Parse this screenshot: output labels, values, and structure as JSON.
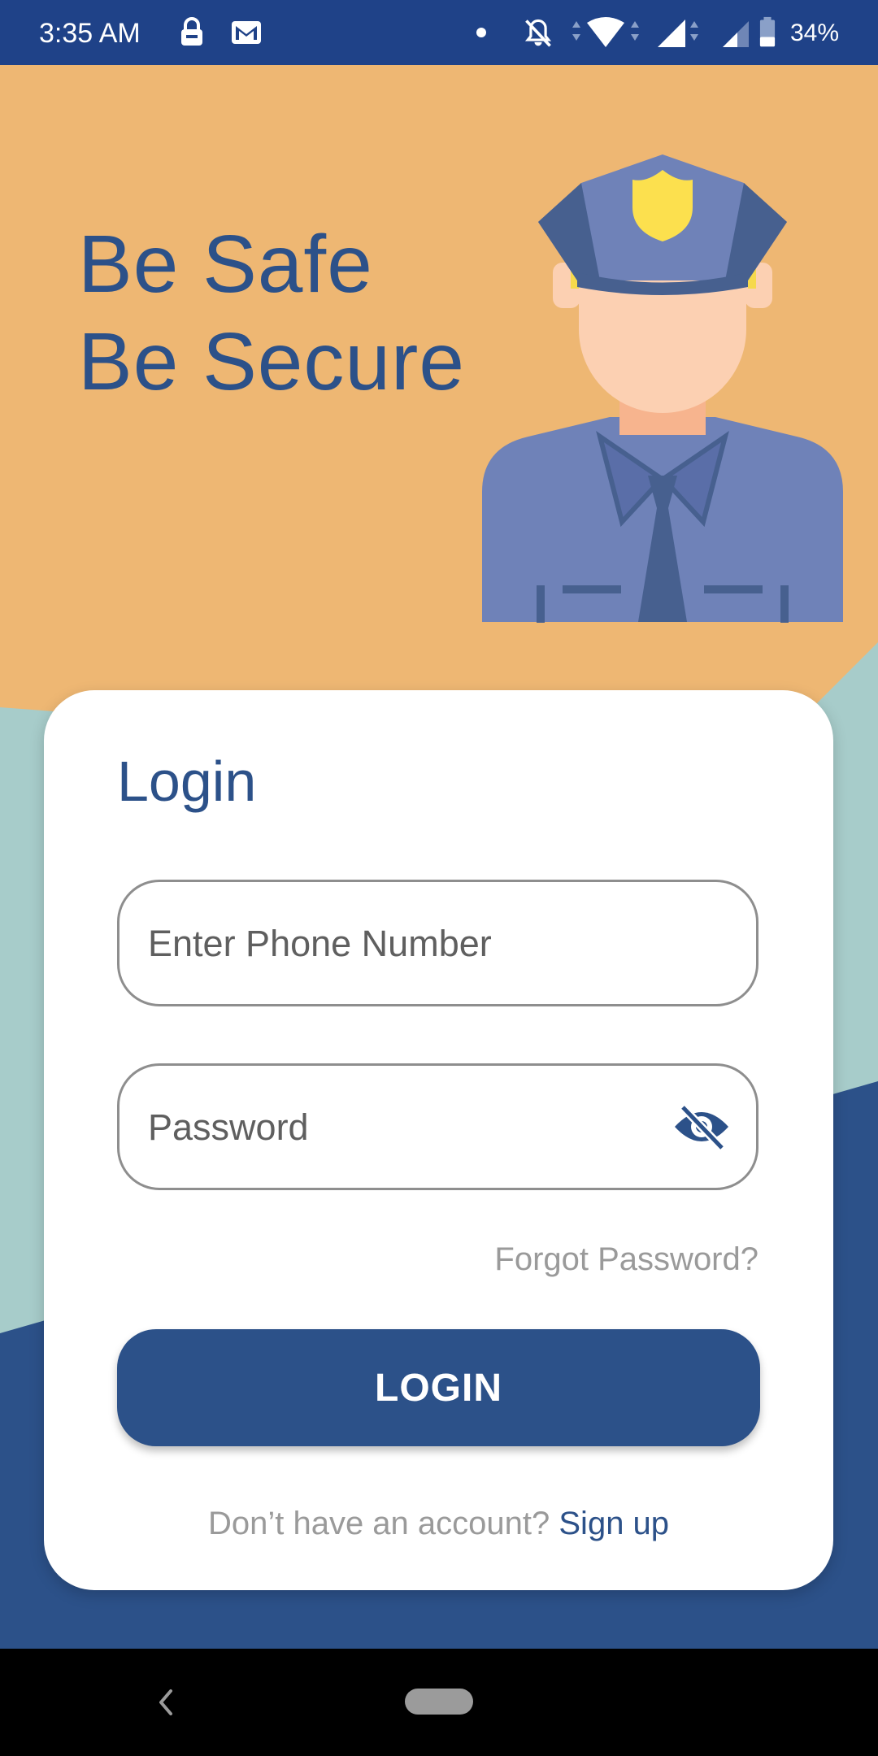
{
  "status_bar": {
    "time": "3:35 AM",
    "battery": "34%",
    "icons": [
      "vpn-lock-icon",
      "gmail-icon",
      "dot-icon",
      "notifications-off-icon",
      "wifi-icon",
      "signal-icon",
      "signal-weak-icon",
      "battery-icon"
    ]
  },
  "hero": {
    "line1": "Be Safe",
    "line2": "Be Secure"
  },
  "login": {
    "title": "Login",
    "phone_placeholder": "Enter Phone Number",
    "password_placeholder": "Password",
    "forgot_password": "Forgot Password?",
    "login_button": "LOGIN",
    "signup_prompt": "Don’t have an account?",
    "signup_link": "Sign up"
  },
  "colors": {
    "primary": "#2c5189",
    "status_bar": "#1f4288",
    "hero_bg": "#eeb773",
    "teal": "#a7ccca"
  }
}
